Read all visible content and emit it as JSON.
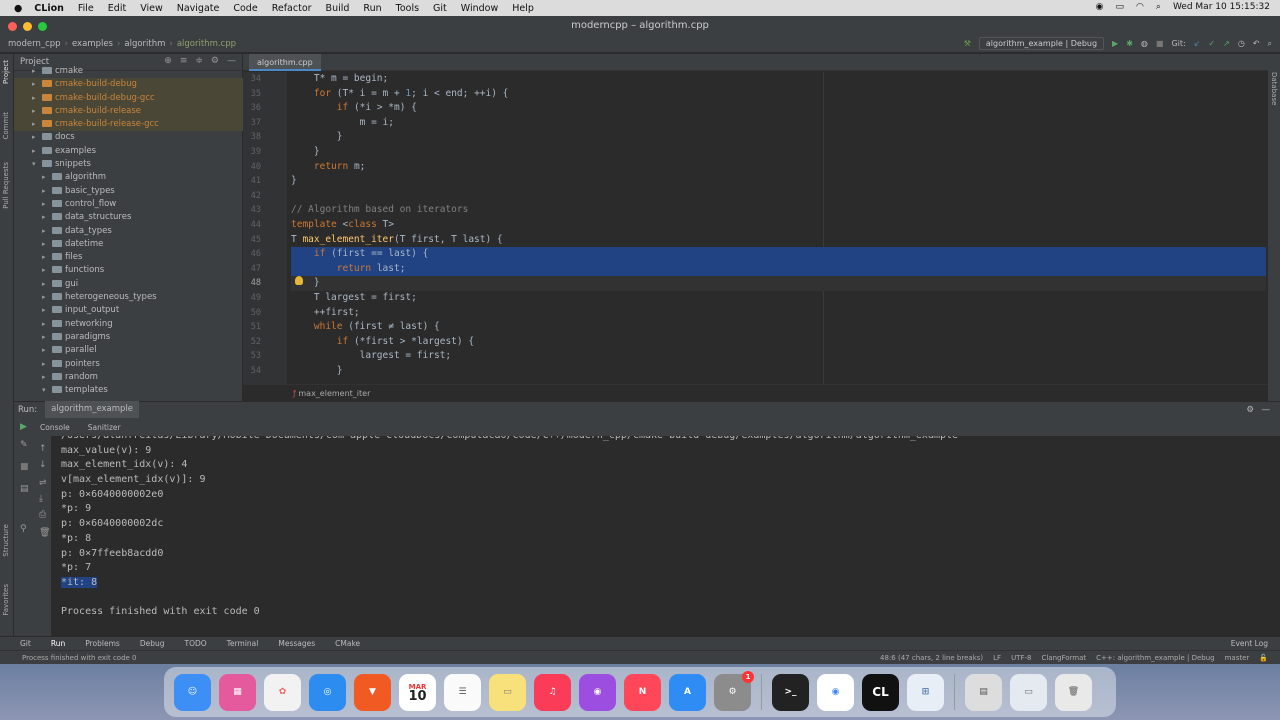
{
  "menubar": {
    "app": "CLion",
    "items": [
      "File",
      "Edit",
      "View",
      "Navigate",
      "Code",
      "Refactor",
      "Build",
      "Run",
      "Tools",
      "Git",
      "Window",
      "Help"
    ],
    "clock": "Wed Mar 10  15:15:32"
  },
  "window": {
    "title": "moderncpp – algorithm.cpp"
  },
  "nav": {
    "crumbs": [
      "modern_cpp",
      "examples",
      "algorithm",
      "algorithm.cpp"
    ],
    "run_config": "algorithm_example | Debug",
    "git_label": "Git:"
  },
  "project": {
    "title": "Project",
    "tree": [
      {
        "label": "cmake",
        "indent": 2,
        "expanded": false,
        "excluded": false
      },
      {
        "label": "cmake-build-debug",
        "indent": 2,
        "expanded": false,
        "excluded": true
      },
      {
        "label": "cmake-build-debug-gcc",
        "indent": 2,
        "expanded": false,
        "excluded": true
      },
      {
        "label": "cmake-build-release",
        "indent": 2,
        "expanded": false,
        "excluded": true
      },
      {
        "label": "cmake-build-release-gcc",
        "indent": 2,
        "expanded": false,
        "excluded": true
      },
      {
        "label": "docs",
        "indent": 2,
        "expanded": false,
        "excluded": false
      },
      {
        "label": "examples",
        "indent": 2,
        "expanded": false,
        "excluded": false
      },
      {
        "label": "snippets",
        "indent": 2,
        "expanded": true,
        "excluded": false
      },
      {
        "label": "algorithm",
        "indent": 3,
        "expanded": false,
        "excluded": false
      },
      {
        "label": "basic_types",
        "indent": 3,
        "expanded": false,
        "excluded": false
      },
      {
        "label": "control_flow",
        "indent": 3,
        "expanded": false,
        "excluded": false
      },
      {
        "label": "data_structures",
        "indent": 3,
        "expanded": false,
        "excluded": false
      },
      {
        "label": "data_types",
        "indent": 3,
        "expanded": false,
        "excluded": false
      },
      {
        "label": "datetime",
        "indent": 3,
        "expanded": false,
        "excluded": false
      },
      {
        "label": "files",
        "indent": 3,
        "expanded": false,
        "excluded": false
      },
      {
        "label": "functions",
        "indent": 3,
        "expanded": false,
        "excluded": false
      },
      {
        "label": "gui",
        "indent": 3,
        "expanded": false,
        "excluded": false
      },
      {
        "label": "heterogeneous_types",
        "indent": 3,
        "expanded": false,
        "excluded": false
      },
      {
        "label": "input_output",
        "indent": 3,
        "expanded": false,
        "excluded": false
      },
      {
        "label": "networking",
        "indent": 3,
        "expanded": false,
        "excluded": false
      },
      {
        "label": "paradigms",
        "indent": 3,
        "expanded": false,
        "excluded": false
      },
      {
        "label": "parallel",
        "indent": 3,
        "expanded": false,
        "excluded": false
      },
      {
        "label": "pointers",
        "indent": 3,
        "expanded": false,
        "excluded": false
      },
      {
        "label": "random",
        "indent": 3,
        "expanded": false,
        "excluded": false
      },
      {
        "label": "templates",
        "indent": 3,
        "expanded": true,
        "excluded": false
      }
    ]
  },
  "editor": {
    "tab": "algorithm.cpp",
    "breadcrumb": "max_element_iter",
    "current_line": 48,
    "lines": [
      {
        "n": 34,
        "t": "    T* m = begin;"
      },
      {
        "n": 35,
        "t": "    for (T* i = m + 1; i < end; ++i) {"
      },
      {
        "n": 36,
        "t": "        if (*i > *m) {"
      },
      {
        "n": 37,
        "t": "            m = i;"
      },
      {
        "n": 38,
        "t": "        }"
      },
      {
        "n": 39,
        "t": "    }"
      },
      {
        "n": 40,
        "t": "    return m;"
      },
      {
        "n": 41,
        "t": "}"
      },
      {
        "n": 42,
        "t": ""
      },
      {
        "n": 43,
        "t": "// Algorithm based on iterators"
      },
      {
        "n": 44,
        "t": "template <class T>"
      },
      {
        "n": 45,
        "t": "T max_element_iter(T first, T last) {"
      },
      {
        "n": 46,
        "t": "    if (first == last) {"
      },
      {
        "n": 47,
        "t": "        return last;"
      },
      {
        "n": 48,
        "t": "    }"
      },
      {
        "n": 49,
        "t": "    T largest = first;"
      },
      {
        "n": 50,
        "t": "    ++first;"
      },
      {
        "n": 51,
        "t": "    while (first ≠ last) {"
      },
      {
        "n": 52,
        "t": "        if (*first > *largest) {"
      },
      {
        "n": 53,
        "t": "            largest = first;"
      },
      {
        "n": 54,
        "t": "        }"
      }
    ]
  },
  "run": {
    "label": "Run:",
    "config": "algorithm_example",
    "tabs": [
      "Console",
      "Sanitizer"
    ],
    "output": [
      "/Users/alanfreitas/Library/Mobile Documents/com~apple~CloudDocs/Computacao/Code/C++/modern_cpp/cmake-build-debug/examples/algorithm/algorithm_example",
      "max_value(v): 9",
      "max_element_idx(v): 4",
      "v[max_element_idx(v)]: 9",
      "p: 0×6040000002e0",
      "*p: 9",
      "p: 0×6040000002dc",
      "*p: 8",
      "p: 0×7ffeeb8acdd0",
      "*p: 7",
      "*it: 8",
      "",
      "Process finished with exit code 0"
    ]
  },
  "toolwindows": [
    "Git",
    "Run",
    "Problems",
    "Debug",
    "TODO",
    "Terminal",
    "Messages",
    "CMake"
  ],
  "event_log": "Event Log",
  "status": {
    "message": "Process finished with exit code 0",
    "position": "48:6 (47 chars, 2 line breaks)",
    "eol": "LF",
    "encoding": "UTF-8",
    "format": "ClangFormat",
    "context": "C++: algorithm_example | Debug",
    "branch": "master"
  },
  "side_tabs": {
    "left": [
      "Project",
      "Commit",
      "Pull Requests"
    ],
    "left_bottom": [
      "Structure",
      "Favorites"
    ],
    "right": [
      "Database"
    ]
  },
  "dock": {
    "calendar_month": "MAR",
    "calendar_day": "10",
    "badge": "1",
    "clion": "CL"
  }
}
